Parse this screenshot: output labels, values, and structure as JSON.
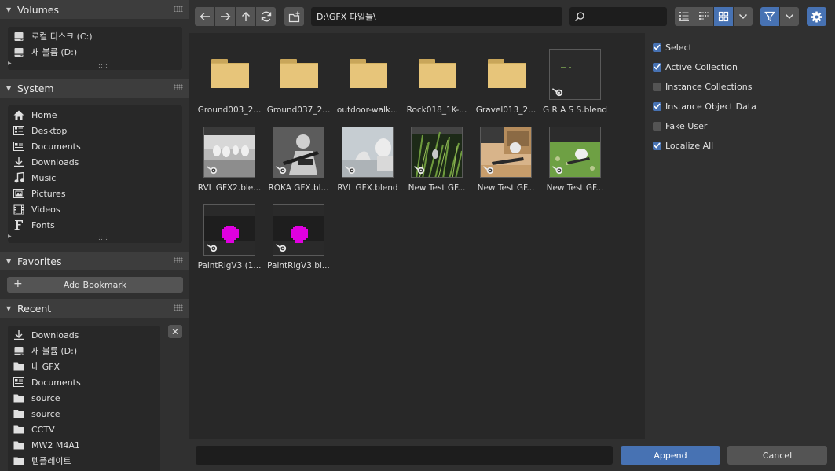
{
  "sidebar": {
    "volumes": {
      "title": "Volumes",
      "items": [
        {
          "label": "로컬 디스크 (C:)",
          "icon": "disk-icon"
        },
        {
          "label": "새 볼륨 (D:)",
          "icon": "disk-icon"
        }
      ]
    },
    "system": {
      "title": "System",
      "items": [
        {
          "label": "Home",
          "icon": "home-icon"
        },
        {
          "label": "Desktop",
          "icon": "desktop-icon"
        },
        {
          "label": "Documents",
          "icon": "documents-icon"
        },
        {
          "label": "Downloads",
          "icon": "download-icon"
        },
        {
          "label": "Music",
          "icon": "music-icon"
        },
        {
          "label": "Pictures",
          "icon": "pictures-icon"
        },
        {
          "label": "Videos",
          "icon": "video-icon"
        },
        {
          "label": "Fonts",
          "icon": "font-icon"
        }
      ]
    },
    "favorites": {
      "title": "Favorites",
      "add_bookmark_label": "Add Bookmark"
    },
    "recent": {
      "title": "Recent",
      "close_glyph": "✕",
      "items": [
        {
          "label": "Downloads",
          "icon": "download-icon"
        },
        {
          "label": "새 볼륨 (D:)",
          "icon": "disk-icon"
        },
        {
          "label": "내 GFX",
          "icon": "folder-icon"
        },
        {
          "label": "Documents",
          "icon": "documents-icon"
        },
        {
          "label": "source",
          "icon": "folder-icon"
        },
        {
          "label": "source",
          "icon": "folder-icon"
        },
        {
          "label": "CCTV",
          "icon": "folder-icon"
        },
        {
          "label": "MW2 M4A1",
          "icon": "folder-icon"
        },
        {
          "label": "템플레이트",
          "icon": "folder-icon"
        }
      ]
    }
  },
  "toolbar": {
    "path": "D:\\GFX 파일들\\",
    "search_value": ""
  },
  "files": [
    {
      "label": "Ground003_2...",
      "type": "folder"
    },
    {
      "label": "Ground037_2...",
      "type": "folder"
    },
    {
      "label": "outdoor-walk...",
      "type": "folder"
    },
    {
      "label": "Rock018_1K-...",
      "type": "folder"
    },
    {
      "label": "Gravel013_2...",
      "type": "folder"
    },
    {
      "label": "G R A S S.blend",
      "type": "blend",
      "preview": "dark"
    },
    {
      "label": "RVL GFX2.ble...",
      "type": "blend",
      "preview": "rvl2"
    },
    {
      "label": "ROKA GFX.bl...",
      "type": "blend",
      "preview": "roka"
    },
    {
      "label": "RVL GFX.blend",
      "type": "blend",
      "preview": "rvl"
    },
    {
      "label": "New Test GF...",
      "type": "blend",
      "preview": "grass"
    },
    {
      "label": "New Test GF...",
      "type": "blend",
      "preview": "trench"
    },
    {
      "label": "New Test GF...",
      "type": "blend",
      "preview": "field"
    },
    {
      "label": "PaintRigV3 (1...",
      "type": "blend",
      "preview": "paint"
    },
    {
      "label": "PaintRigV3.bl...",
      "type": "blend",
      "preview": "paint"
    }
  ],
  "options": [
    {
      "label": "Select",
      "checked": true
    },
    {
      "label": "Active Collection",
      "checked": true
    },
    {
      "label": "Instance Collections",
      "checked": false
    },
    {
      "label": "Instance Object Data",
      "checked": true
    },
    {
      "label": "Fake User",
      "checked": false
    },
    {
      "label": "Localize All",
      "checked": true
    }
  ],
  "bottom": {
    "filename_value": "",
    "append_label": "Append",
    "cancel_label": "Cancel"
  },
  "colors": {
    "accent": "#4772b3",
    "folder": "#e7c57a",
    "background": "#303030",
    "list_background": "#282828"
  }
}
